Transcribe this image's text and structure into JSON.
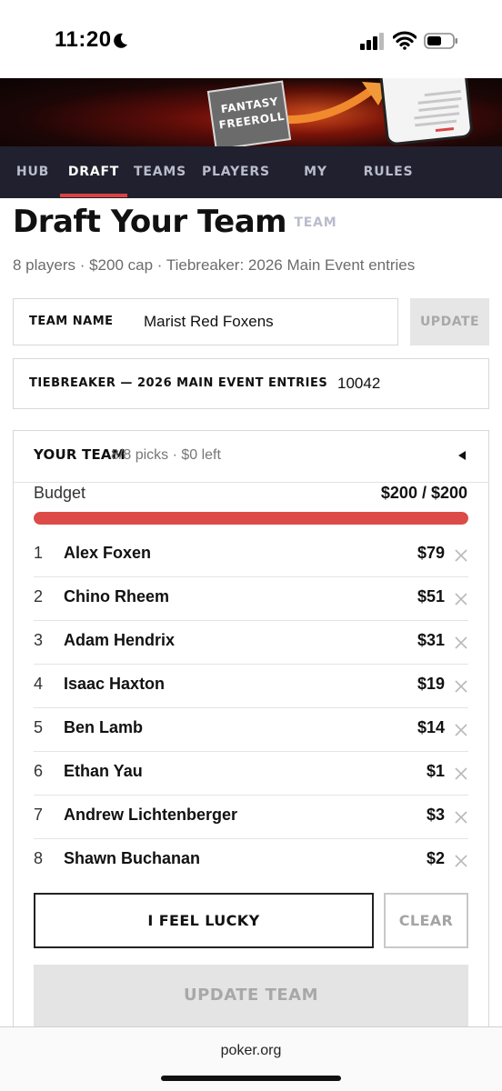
{
  "status_bar": {
    "time": "11:20"
  },
  "banner": {
    "logo_line1": "FANTASY",
    "logo_line2": "FREEROLL"
  },
  "nav": {
    "items": [
      {
        "label": "HUB"
      },
      {
        "label": "DRAFT",
        "active": true
      },
      {
        "label": "TEAMS"
      },
      {
        "label": "PLAYERS"
      },
      {
        "label": "MY TEAM"
      },
      {
        "label": "RULES"
      }
    ]
  },
  "page": {
    "title": "Draft Your Team",
    "subtitle": "8 players · $200 cap · Tiebreaker: 2026 Main Event entries"
  },
  "team_name": {
    "label": "TEAM NAME",
    "value": "Marist Red Foxens",
    "update_label": "UPDATE"
  },
  "tiebreaker": {
    "label": "TIEBREAKER — 2026 MAIN EVENT ENTRIES",
    "value": "10042"
  },
  "your_team": {
    "title": "YOUR TEAM",
    "meta": "8/8 picks · $0 left",
    "budget_label": "Budget",
    "budget_value": "$200 / $200",
    "budget_fraction": 1.0,
    "picks": [
      {
        "num": "1",
        "name": "Alex Foxen",
        "price": "$79"
      },
      {
        "num": "2",
        "name": "Chino Rheem",
        "price": "$51"
      },
      {
        "num": "3",
        "name": "Adam Hendrix",
        "price": "$31"
      },
      {
        "num": "4",
        "name": "Isaac Haxton",
        "price": "$19"
      },
      {
        "num": "5",
        "name": "Ben Lamb",
        "price": "$14"
      },
      {
        "num": "6",
        "name": "Ethan Yau",
        "price": "$1"
      },
      {
        "num": "7",
        "name": "Andrew Lichtenberger",
        "price": "$3"
      },
      {
        "num": "8",
        "name": "Shawn Buchanan",
        "price": "$2"
      }
    ],
    "lucky_label": "I FEEL LUCKY",
    "clear_label": "CLEAR",
    "update_team_label": "UPDATE TEAM"
  },
  "browser": {
    "url": "poker.org"
  },
  "colors": {
    "accent": "#dc4b48",
    "nav_bg": "#20202e"
  }
}
